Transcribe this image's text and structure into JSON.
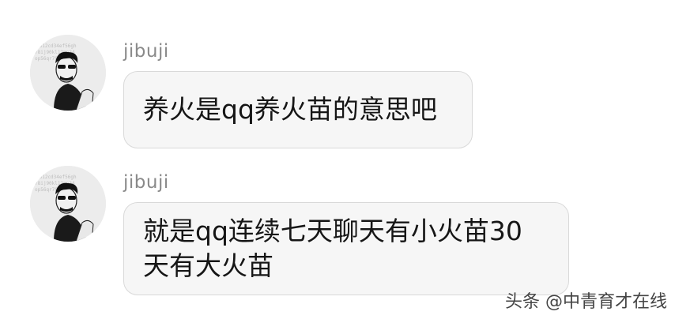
{
  "messages": [
    {
      "username": "jibuji",
      "lines": [
        "养火是qq养火苗的意思吧"
      ]
    },
    {
      "username": "jibuji",
      "lines": [
        "就是qq连续七天聊天有小火苗30",
        "天有大火苗"
      ]
    }
  ],
  "watermark": "头条 @中青育才在线",
  "colors": {
    "bubble_bg": "#f6f6f6",
    "bubble_border": "#d9d9d9",
    "username": "#8a8a8a"
  }
}
